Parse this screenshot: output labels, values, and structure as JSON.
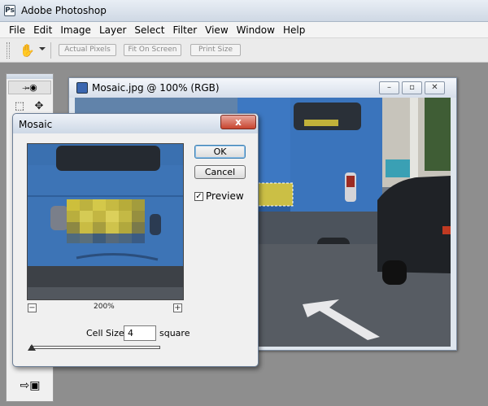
{
  "app": {
    "title": "Adobe Photoshop",
    "icon": "photoshop-icon"
  },
  "menu": [
    "File",
    "Edit",
    "Image",
    "Layer",
    "Select",
    "Filter",
    "View",
    "Window",
    "Help"
  ],
  "options_bar": {
    "buttons": [
      "Actual Pixels",
      "Fit On Screen",
      "Print Size"
    ],
    "tool_icon": "hand-icon"
  },
  "document": {
    "title": "Mosaic.jpg @ 100% (RGB)",
    "controls": [
      "minimize",
      "maximize",
      "close"
    ]
  },
  "dialog": {
    "title": "Mosaic",
    "close_glyph": "x",
    "ok_label": "OK",
    "cancel_label": "Cancel",
    "preview_label": "Preview",
    "preview_checked": true,
    "zoom_label": "200%",
    "zoom_out_glyph": "−",
    "zoom_in_glyph": "+",
    "cell_size_label": "Cell Size:",
    "cell_size_value": "4",
    "cell_size_unit": "square"
  },
  "colors": {
    "bus_blue": "#3d78c2",
    "plate_yellow": "#c9c241",
    "road": "#52565c",
    "canvas_bg": "#8e8e8e"
  }
}
